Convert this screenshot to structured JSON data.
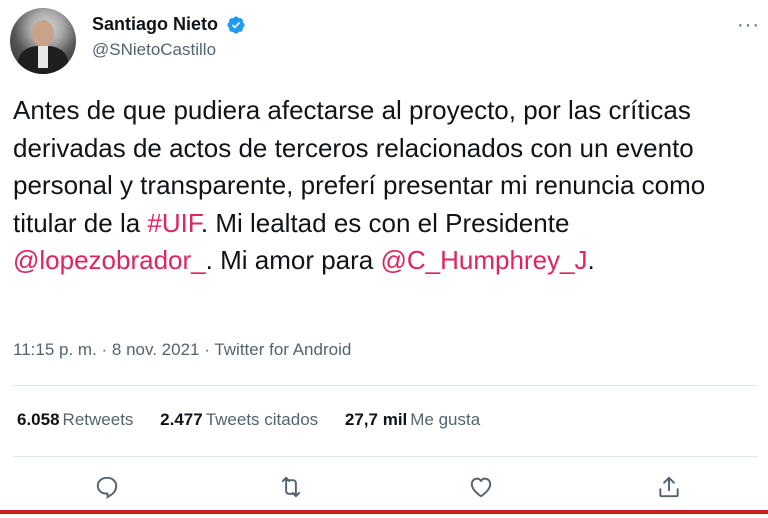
{
  "author": {
    "display_name": "Santiago Nieto",
    "handle": "@SNietoCastillo"
  },
  "tweet": {
    "segments": [
      {
        "text": "Antes de que pudiera afectarse al proyecto, por las críticas derivadas de actos de terceros relacionados con un evento personal y transparente, preferí presentar mi renuncia como titular de la ",
        "link": false
      },
      {
        "text": "#UIF",
        "link": true
      },
      {
        "text": ". Mi lealtad es con el Presidente ",
        "link": false
      },
      {
        "text": "@lopezobrador_",
        "link": true
      },
      {
        "text": ". Mi amor para ",
        "link": false
      },
      {
        "text": "@C_Humphrey_J",
        "link": true
      },
      {
        "text": ".",
        "link": false
      }
    ]
  },
  "meta": {
    "time": "11:15 p. m.",
    "separator1": " · ",
    "date": "8 nov. 2021",
    "separator2": " · ",
    "source": "Twitter for Android"
  },
  "stats": {
    "retweets_count": "6.058",
    "retweets_label": "Retweets",
    "quotes_count": "2.477",
    "quotes_label": "Tweets citados",
    "likes_count": "27,7 mil",
    "likes_label": "Me gusta"
  },
  "more_label": "···",
  "colors": {
    "link": "#e0245e",
    "secondary_text": "#536471",
    "verified": "#1d9bf0",
    "bottom_bar": "#c7211d"
  },
  "icons": [
    "verified-icon",
    "more-icon",
    "reply-icon",
    "retweet-icon",
    "like-icon",
    "share-icon"
  ]
}
